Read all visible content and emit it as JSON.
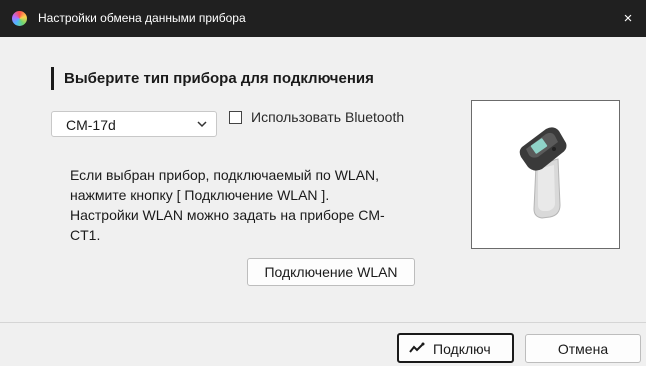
{
  "window": {
    "title": "Настройки обмена данными прибора",
    "app_icon": "color-wheel-icon",
    "close_icon": "close-icon",
    "close_glyph": "×"
  },
  "main": {
    "heading": "Выберите тип прибора для подключения",
    "device_select": {
      "value": "CM-17d",
      "icon": "chevron-down-icon"
    },
    "bluetooth": {
      "label": "Использовать Bluetooth",
      "checked": false
    },
    "info_lines": [
      "Если выбран прибор, подключаемый по WLAN,",
      "нажмите кнопку [ Подключение WLAN ].",
      "Настройки WLAN можно задать на приборе CM-",
      "CT1."
    ],
    "wlan_button": "Подключение WLAN",
    "device_image_icon": "spectrophotometer-device-icon"
  },
  "footer": {
    "connect_button": "Подключ",
    "connect_icon": "connection-signal-icon",
    "cancel_button": "Отмена"
  },
  "colors": {
    "titlebar": "#202020",
    "dialog_bg": "#f0f0f0",
    "text": "#1a1a1a"
  }
}
